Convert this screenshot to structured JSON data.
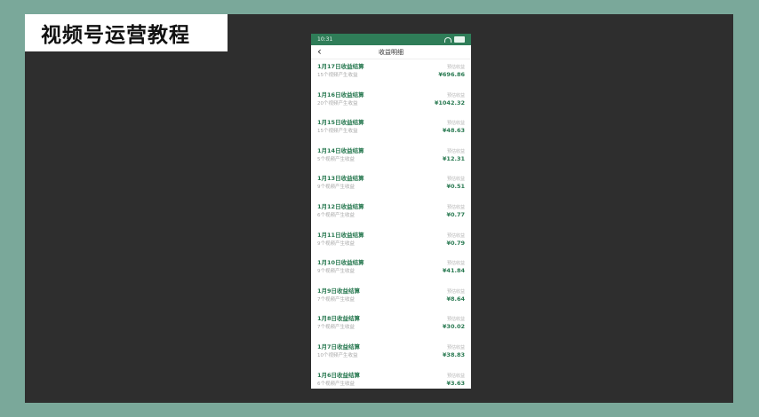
{
  "banner": {
    "text": "视频号运营教程"
  },
  "phone": {
    "status": {
      "time": "10:31"
    },
    "nav": {
      "title": "收益明细"
    },
    "rows": [
      {
        "title": "1月17日收益结算",
        "sub": "15个视频产生收益",
        "label": "预估收益",
        "amount": "¥696.86"
      },
      {
        "title": "1月16日收益结算",
        "sub": "20个视频产生收益",
        "label": "预估收益",
        "amount": "¥1042.32"
      },
      {
        "title": "1月15日收益结算",
        "sub": "15个视频产生收益",
        "label": "预估收益",
        "amount": "¥48.63"
      },
      {
        "title": "1月14日收益结算",
        "sub": "5个视频产生收益",
        "label": "预估收益",
        "amount": "¥12.31"
      },
      {
        "title": "1月13日收益结算",
        "sub": "9个视频产生收益",
        "label": "预估收益",
        "amount": "¥0.51"
      },
      {
        "title": "1月12日收益结算",
        "sub": "6个视频产生收益",
        "label": "预估收益",
        "amount": "¥0.77"
      },
      {
        "title": "1月11日收益结算",
        "sub": "9个视频产生收益",
        "label": "预估收益",
        "amount": "¥0.79"
      },
      {
        "title": "1月10日收益结算",
        "sub": "9个视频产生收益",
        "label": "预估收益",
        "amount": "¥41.84"
      },
      {
        "title": "1月9日收益结算",
        "sub": "7个视频产生收益",
        "label": "预估收益",
        "amount": "¥8.64"
      },
      {
        "title": "1月8日收益结算",
        "sub": "7个视频产生收益",
        "label": "预估收益",
        "amount": "¥30.02"
      },
      {
        "title": "1月7日收益结算",
        "sub": "10个视频产生收益",
        "label": "预估收益",
        "amount": "¥38.83"
      },
      {
        "title": "1月6日收益结算",
        "sub": "6个视频产生收益",
        "label": "预估收益",
        "amount": "¥3.63"
      }
    ]
  }
}
